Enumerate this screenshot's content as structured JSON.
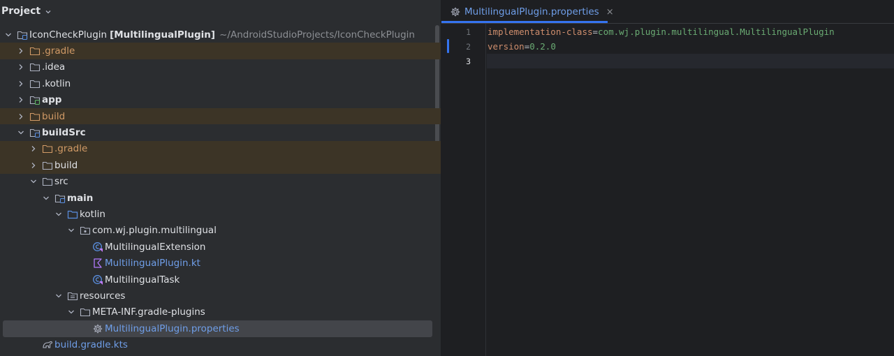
{
  "project_panel": {
    "title": "Project",
    "tree": [
      {
        "label": "IconCheckPlugin",
        "suffix": "[MultilingualPlugin]",
        "path": "~/AndroidStudioProjects/IconCheckPlugin"
      },
      {
        "label": ".gradle"
      },
      {
        "label": ".idea"
      },
      {
        "label": ".kotlin"
      },
      {
        "label": "app"
      },
      {
        "label": "build"
      },
      {
        "label": "buildSrc"
      },
      {
        "label": ".gradle"
      },
      {
        "label": "build"
      },
      {
        "label": "src"
      },
      {
        "label": "main"
      },
      {
        "label": "kotlin"
      },
      {
        "label": "com.wj.plugin.multilingual"
      },
      {
        "label": "MultilingualExtension"
      },
      {
        "label": "MultilingualPlugin.kt"
      },
      {
        "label": "MultilingualTask"
      },
      {
        "label": "resources"
      },
      {
        "label": "META-INF.gradle-plugins"
      },
      {
        "label": "MultilingualPlugin.properties"
      },
      {
        "label": "build.gradle.kts"
      }
    ]
  },
  "editor": {
    "tab_label": "MultilingualPlugin.properties",
    "tab_close": "×",
    "line_numbers": [
      "1",
      "2",
      "3"
    ],
    "lines": [
      {
        "key": "implementation-class",
        "eq": "=",
        "value": "com.wj.plugin.multilingual.MultilingualPlugin"
      },
      {
        "key": "version",
        "eq": "=",
        "value": "0.2.0"
      },
      {
        "key": "",
        "eq": "",
        "value": ""
      }
    ]
  },
  "colors": {
    "accent": "#3574f0",
    "excluded_row": "#3c3426",
    "key": "#cf8e6d",
    "value": "#6aab73"
  }
}
